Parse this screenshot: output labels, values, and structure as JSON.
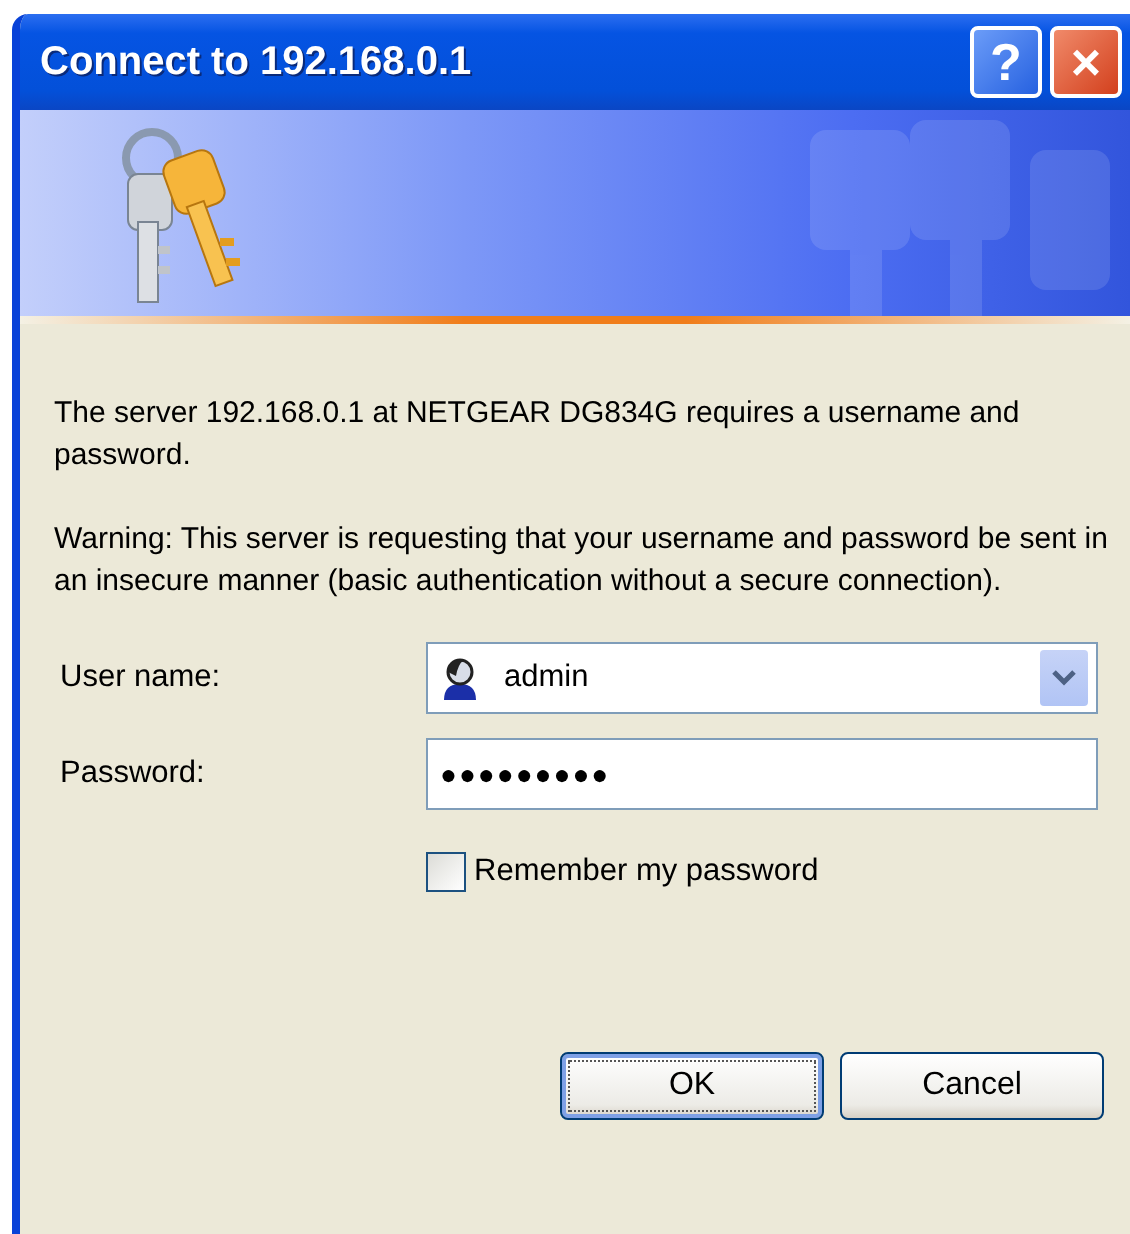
{
  "window": {
    "title": "Connect to 192.168.0.1",
    "buttons": [
      {
        "kind": "help",
        "label": "?"
      },
      {
        "kind": "close",
        "label": "×"
      }
    ]
  },
  "message": "The server 192.168.0.1 at NETGEAR DG834G  requires a username and password.",
  "warning": "Warning: This server is requesting that your username and password be sent in an insecure manner (basic authentication without a secure connection).",
  "fields": [
    {
      "kind": "combo",
      "label": "User name:",
      "value": "admin"
    },
    {
      "kind": "password",
      "label": "Password:",
      "value": "●●●●●●●●●"
    }
  ],
  "remember": {
    "label": "Remember my password",
    "checked": false
  },
  "buttons": [
    {
      "label": "OK",
      "default": true
    },
    {
      "label": "Cancel",
      "default": false
    }
  ]
}
